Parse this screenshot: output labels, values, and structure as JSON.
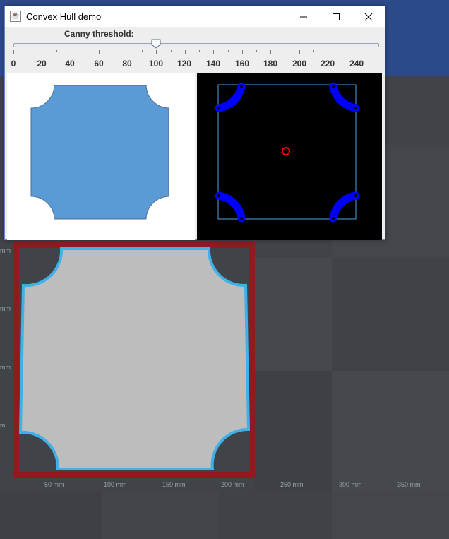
{
  "window": {
    "title": "Convex Hull demo",
    "icon": "java-cup-icon",
    "controls": [
      "minimize-icon",
      "maximize-icon",
      "close-icon"
    ]
  },
  "slider": {
    "label": "Canny threshold:",
    "min": 0,
    "max": 255,
    "value": 100,
    "tick_labels": [
      "0",
      "20",
      "40",
      "60",
      "80",
      "100",
      "120",
      "140",
      "160",
      "180",
      "200",
      "220",
      "240"
    ]
  },
  "panels": {
    "source": {
      "shape": "rounded-notched-square",
      "fill": "#5b9bd5"
    },
    "result": {
      "background": "#000000",
      "contour_color": "#0000ff",
      "hull_color": "#4aa3df",
      "center_color": "#ff0000"
    }
  },
  "viewport": {
    "axis_labels": [
      "50 mm",
      "100 mm",
      "150 mm",
      "200 mm",
      "250 mm",
      "300 mm",
      "350 mm"
    ],
    "left_labels": [
      "mm",
      "mm",
      "mm",
      "m"
    ],
    "frame_color": "#8e1b1f",
    "part_color": "#bdbdbd",
    "outline_color": "#3fb0e8"
  }
}
